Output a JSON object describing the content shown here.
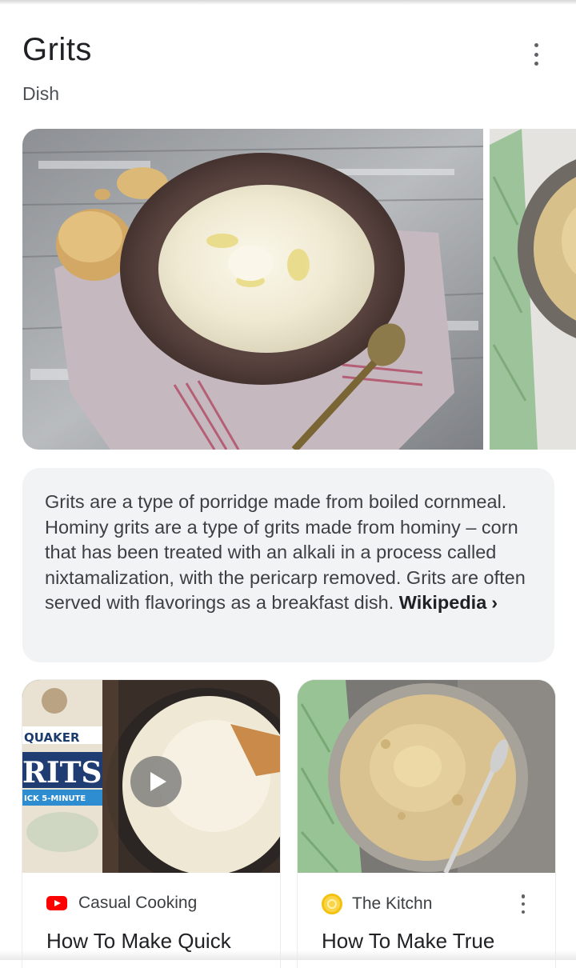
{
  "header": {
    "title": "Grits",
    "subtitle": "Dish"
  },
  "description": {
    "text": "Grits are a type of porridge made from boiled cornmeal. Hominy grits are a type of grits made from hominy – corn that has been treated with an alkali in a process called nixtamalization, with the pericarp removed. Grits are often served with flavorings as a breakfast dish.",
    "source_label": "Wikipedia",
    "chevron": "›"
  },
  "cards": [
    {
      "source": "Casual Cooking",
      "title": "How To Make Quick",
      "has_video": true,
      "source_icon": "youtube-icon",
      "package_text_brand": "QUAKER",
      "package_text_product": "RITS",
      "package_text_sub": "ICK 5-MINUTE"
    },
    {
      "source": "The Kitchn",
      "title": "How To Make True",
      "has_video": false,
      "source_icon": "kitchn-icon"
    }
  ],
  "icons": {
    "more": "more-vert-icon",
    "play": "play-icon"
  },
  "colors": {
    "youtube_red": "#ff0000",
    "kitchn_yellow": "#f4c20d",
    "card_bg": "#f1f3f4"
  }
}
